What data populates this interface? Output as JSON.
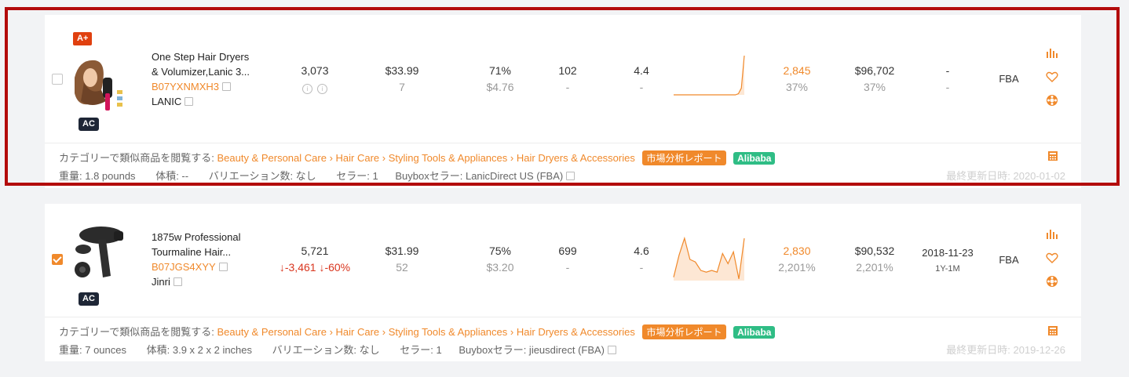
{
  "products": [
    {
      "aplus_badge": "A+",
      "ac_badge": "AC",
      "checked": false,
      "title_line1": "One Step Hair Dryers",
      "title_line2": "& Volumizer,Lanic 3...",
      "asin": "B07YXNMXH3",
      "brand": "LANIC",
      "rank": "3,073",
      "rank_change": "",
      "price": "$33.99",
      "price_sub": "7",
      "margin": "71%",
      "margin_sub": "$4.76",
      "reviews": "102",
      "reviews_sub": "-",
      "rating": "4.4",
      "rating_sub": "-",
      "sales": "2,845",
      "sales_pct": "37%",
      "revenue": "$96,702",
      "revenue_pct": "37%",
      "date": "-",
      "date_sub": "-",
      "fulfillment": "FBA",
      "category_prefix": "カテゴリーで類似商品を閲覧する:",
      "breadcrumb": [
        "Beauty & Personal Care",
        "Hair Care",
        "Styling Tools & Appliances",
        "Hair Dryers & Accessories"
      ],
      "report_tag": "市場分析レポート",
      "alibaba_tag": "Alibaba",
      "weight": "重量: 1.8 pounds",
      "volume": "体積: --",
      "variation": "バリエーション数: なし",
      "sellers": "セラー: 1",
      "buybox": "Buyboxセラー:  LanicDirect US  (FBA)",
      "updated": "最終更新日時: 2020-01-02",
      "sparkline": [
        0,
        0,
        0,
        0,
        0,
        0,
        0,
        0,
        0,
        0,
        0,
        0,
        0,
        0,
        0,
        0,
        0,
        0,
        0,
        0,
        0,
        0,
        1,
        6,
        35
      ]
    },
    {
      "aplus_badge": "",
      "ac_badge": "AC",
      "checked": true,
      "title_line1": "1875w Professional",
      "title_line2": "Tourmaline Hair...",
      "asin": "B07JGS4XYY",
      "brand": "Jinri",
      "rank": "5,721",
      "rank_change": "↓-3,461  ↓-60%",
      "price": "$31.99",
      "price_sub": "52",
      "margin": "75%",
      "margin_sub": "$3.20",
      "reviews": "699",
      "reviews_sub": "-",
      "rating": "4.6",
      "rating_sub": "-",
      "sales": "2,830",
      "sales_pct": "2,201%",
      "revenue": "$90,532",
      "revenue_pct": "2,201%",
      "date": "2018-11-23",
      "date_sub": "1Y-1M",
      "fulfillment": "FBA",
      "category_prefix": "カテゴリーで類似商品を閲覧する:",
      "breadcrumb": [
        "Beauty & Personal Care",
        "Hair Care",
        "Styling Tools & Appliances",
        "Hair Dryers & Accessories"
      ],
      "report_tag": "市場分析レポート",
      "alibaba_tag": "Alibaba",
      "weight": "重量: 7 ounces",
      "volume": "体積: 3.9 x 2 x 2 inches",
      "variation": "バリエーション数: なし",
      "sellers": "セラー: 1",
      "buybox": "Buyboxセラー:  jieusdirect  (FBA)",
      "updated": "最終更新日時: 2019-12-26",
      "sparkline": [
        4,
        30,
        50,
        25,
        22,
        12,
        10,
        12,
        10,
        32,
        20,
        34,
        2,
        50
      ]
    }
  ],
  "icons": {
    "bar": "bar-chart-icon",
    "heart": "heart-icon",
    "pin": "track-icon",
    "calc": "calculator-icon"
  }
}
